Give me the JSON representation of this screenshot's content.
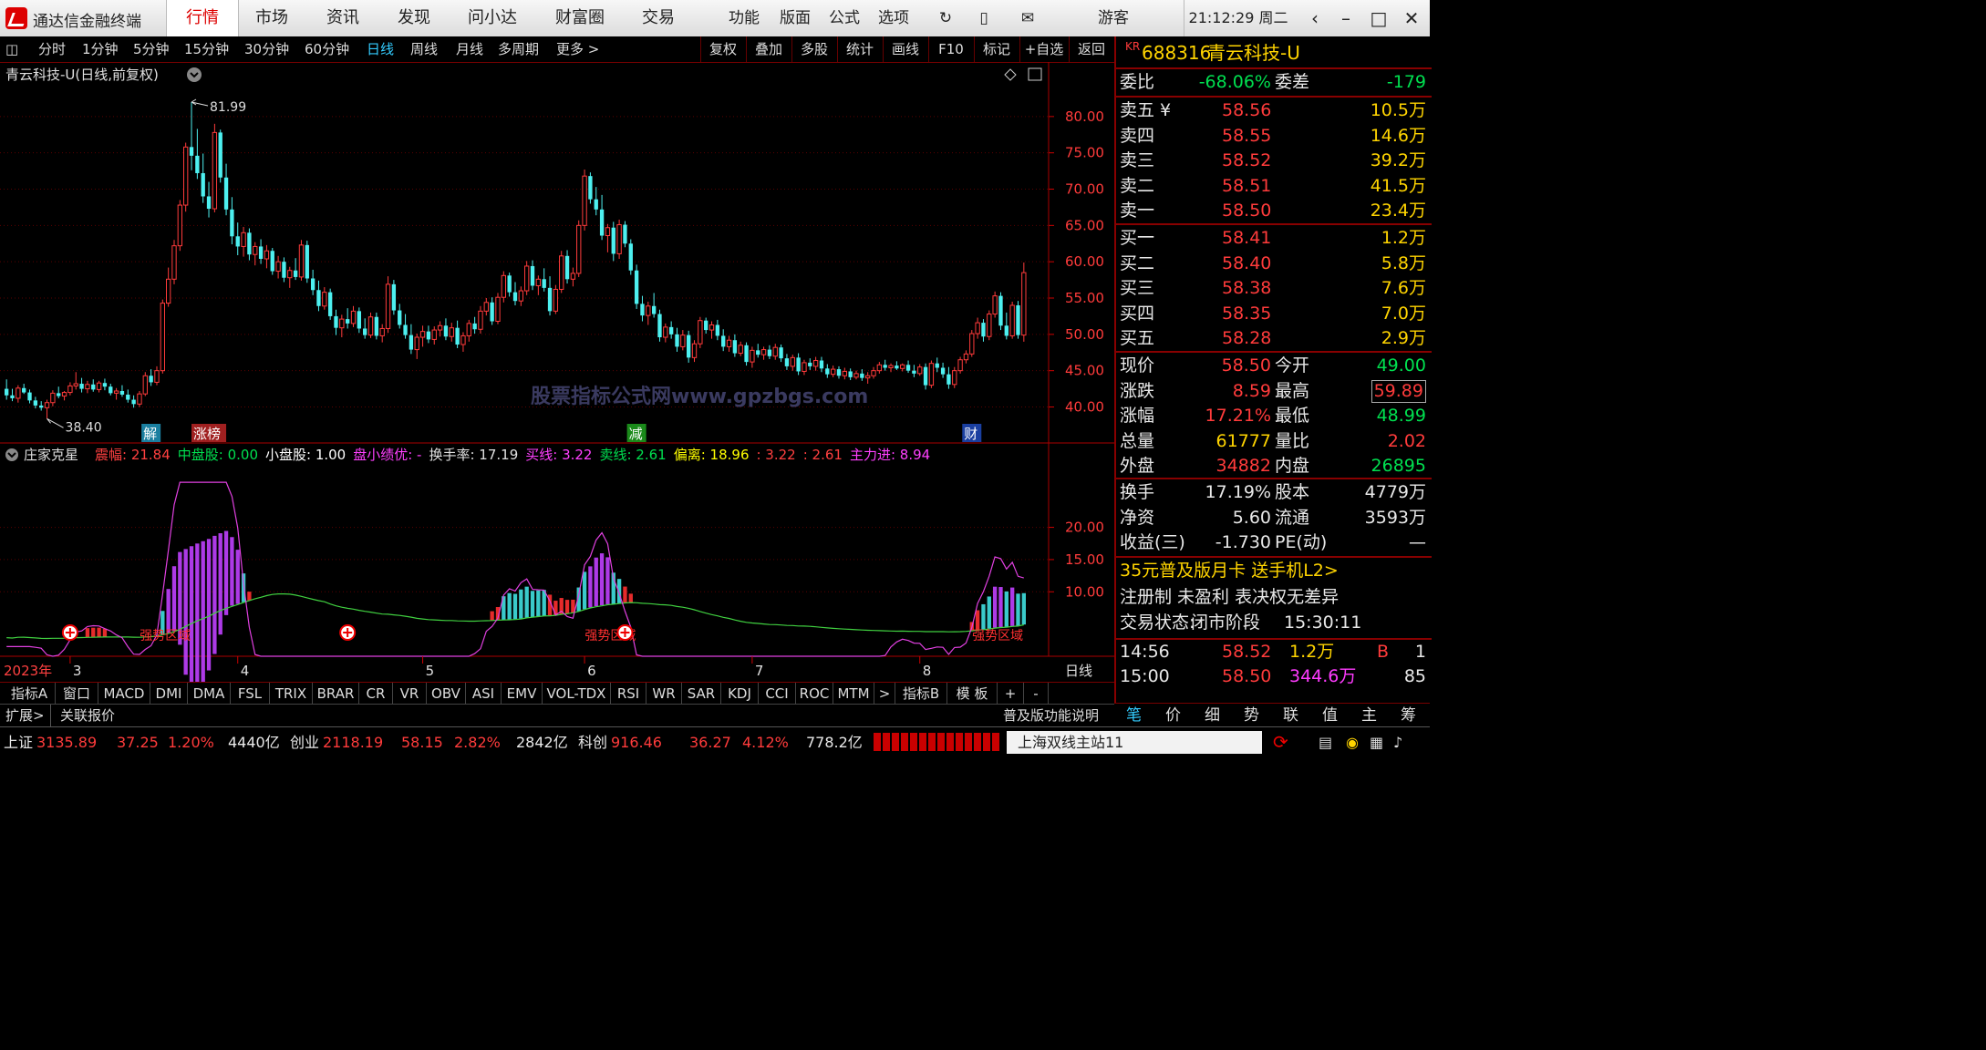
{
  "window": {
    "app_title": "通达信金融终端",
    "nav_tabs": [
      "行情",
      "市场",
      "资讯",
      "发现",
      "问小达",
      "财富圈",
      "交易"
    ],
    "active_tab": 0,
    "tools": [
      "功能",
      "版面",
      "公式",
      "选项"
    ],
    "guest": "游客",
    "clock": "21:12:29 周二"
  },
  "toolbar": {
    "periods": [
      "分时",
      "1分钟",
      "5分钟",
      "15分钟",
      "30分钟",
      "60分钟",
      "日线",
      "周线",
      "月线",
      "多周期",
      "更多 >"
    ],
    "active_period": 6,
    "right_buttons": [
      "复权",
      "叠加",
      "多股",
      "统计",
      "画线",
      "F10",
      "标记",
      "+自选",
      "返回"
    ]
  },
  "main_chart": {
    "title": "青云科技-U(日线,前复权)",
    "y_ticks": [
      "80.00",
      "75.00",
      "70.00",
      "65.00",
      "60.00",
      "55.00",
      "50.00",
      "45.00",
      "40.00"
    ],
    "y_range": [
      36.8,
      84.5
    ],
    "high_label": "81.99",
    "low_label": "38.40",
    "events": [
      {
        "label": "解",
        "color": "#1a7fa0",
        "bar": 25
      },
      {
        "label": "涨榜",
        "color": "#a02020",
        "bar": 35
      },
      {
        "label": "减",
        "color": "#1a8a1a",
        "bar": 109
      },
      {
        "label": "财",
        "color": "#1a3fa0",
        "bar": 167
      }
    ],
    "watermark": "股票指标公式网www.gpzbgs.com",
    "colors": {
      "up": "#ff3b3b",
      "down": "#4df0f0",
      "grid": "#5a0000"
    }
  },
  "indicator": {
    "name": "庄家克星",
    "legend": [
      {
        "text": "震幅: 21.84",
        "color": "#ff4040"
      },
      {
        "text": "中盘股: 0.00",
        "color": "#00e050"
      },
      {
        "text": "小盘股: 1.00",
        "color": "#ffffff"
      },
      {
        "text": "盘小绩优: -",
        "color": "#ff40ff"
      },
      {
        "text": "换手率: 17.19",
        "color": "#e0e0e0"
      },
      {
        "text": "买线: 3.22",
        "color": "#ff40ff"
      },
      {
        "text": "卖线: 2.61",
        "color": "#00e050"
      },
      {
        "text": "偏离: 18.96",
        "color": "#ffff00"
      },
      {
        "text": ": 3.22",
        "color": "#ff4040"
      },
      {
        "text": ": 2.61",
        "color": "#ff4040"
      },
      {
        "text": "主力进: 8.94",
        "color": "#ff40ff"
      }
    ],
    "y_ticks": [
      "20.00",
      "15.00",
      "10.00"
    ],
    "y_range": [
      0,
      28
    ],
    "zone_label": "强势区域",
    "year_label": "2023年",
    "month_labels": [
      {
        "label": "3",
        "bar": 11
      },
      {
        "label": "4",
        "bar": 40
      },
      {
        "label": "5",
        "bar": 72
      },
      {
        "label": "6",
        "bar": 100
      },
      {
        "label": "7",
        "bar": 129
      },
      {
        "label": "8",
        "bar": 158
      }
    ],
    "period_label": "日线"
  },
  "chart_data": {
    "type": "candlestick",
    "title": "青云科技-U(日线,前复权)",
    "ylim": [
      36.8,
      84.5
    ],
    "candles": [
      [
        42.5,
        43.8,
        41.0,
        41.6
      ],
      [
        41.6,
        42.5,
        40.8,
        41.2
      ],
      [
        41.2,
        43.0,
        40.6,
        42.6
      ],
      [
        42.6,
        43.2,
        41.8,
        42.0
      ],
      [
        42.0,
        42.4,
        40.5,
        40.9
      ],
      [
        40.9,
        41.4,
        39.8,
        40.2
      ],
      [
        40.2,
        40.8,
        39.5,
        39.9
      ],
      [
        39.9,
        41.0,
        38.4,
        40.6
      ],
      [
        40.6,
        42.3,
        40.1,
        41.9
      ],
      [
        41.9,
        42.8,
        41.2,
        41.5
      ],
      [
        41.5,
        42.2,
        40.9,
        42.0
      ],
      [
        42.0,
        43.4,
        41.6,
        42.9
      ],
      [
        42.9,
        44.8,
        42.4,
        43.2
      ],
      [
        43.2,
        44.0,
        42.0,
        42.5
      ],
      [
        42.5,
        43.6,
        41.9,
        43.1
      ],
      [
        43.1,
        43.8,
        42.1,
        42.4
      ],
      [
        42.4,
        43.6,
        42.0,
        43.3
      ],
      [
        43.3,
        43.9,
        42.3,
        42.8
      ],
      [
        42.8,
        43.2,
        41.6,
        41.9
      ],
      [
        41.9,
        42.6,
        41.0,
        42.2
      ],
      [
        42.2,
        43.0,
        41.4,
        41.7
      ],
      [
        41.7,
        42.4,
        40.6,
        41.0
      ],
      [
        41.0,
        41.6,
        39.9,
        40.4
      ],
      [
        40.4,
        42.2,
        40.0,
        41.8
      ],
      [
        41.8,
        44.8,
        41.5,
        44.3
      ],
      [
        44.3,
        45.2,
        42.9,
        43.4
      ],
      [
        43.4,
        45.6,
        43.0,
        45.0
      ],
      [
        45.0,
        54.8,
        44.6,
        54.3
      ],
      [
        54.3,
        59.2,
        53.8,
        57.6
      ],
      [
        57.6,
        63.0,
        56.9,
        62.2
      ],
      [
        62.2,
        68.5,
        61.5,
        67.8
      ],
      [
        67.8,
        76.4,
        66.9,
        75.8
      ],
      [
        75.8,
        81.99,
        72.6,
        74.6
      ],
      [
        74.6,
        78.3,
        71.4,
        72.2
      ],
      [
        72.2,
        74.9,
        68.1,
        69.0
      ],
      [
        69.0,
        71.0,
        66.1,
        67.3
      ],
      [
        67.3,
        79.0,
        66.8,
        77.8
      ],
      [
        77.8,
        78.2,
        70.9,
        71.6
      ],
      [
        71.6,
        73.5,
        66.4,
        67.2
      ],
      [
        67.2,
        68.9,
        62.4,
        63.5
      ],
      [
        63.5,
        65.4,
        60.9,
        62.1
      ],
      [
        62.1,
        64.8,
        60.7,
        64.0
      ],
      [
        64.0,
        64.6,
        60.2,
        61.0
      ],
      [
        61.0,
        62.7,
        59.5,
        62.1
      ],
      [
        62.1,
        63.1,
        59.7,
        60.4
      ],
      [
        60.4,
        62.3,
        59.1,
        61.5
      ],
      [
        61.5,
        61.9,
        58.2,
        58.7
      ],
      [
        58.7,
        60.8,
        57.7,
        60.0
      ],
      [
        60.0,
        60.6,
        57.2,
        57.8
      ],
      [
        57.8,
        59.3,
        56.4,
        58.8
      ],
      [
        58.8,
        60.5,
        57.5,
        57.9
      ],
      [
        57.9,
        63.0,
        57.4,
        62.3
      ],
      [
        62.3,
        62.9,
        57.1,
        57.7
      ],
      [
        57.7,
        58.9,
        55.4,
        56.1
      ],
      [
        56.1,
        57.4,
        53.2,
        53.9
      ],
      [
        53.9,
        56.5,
        53.4,
        55.8
      ],
      [
        55.8,
        56.3,
        52.0,
        52.5
      ],
      [
        52.5,
        53.4,
        49.9,
        50.9
      ],
      [
        50.9,
        52.7,
        49.6,
        52.1
      ],
      [
        52.1,
        53.6,
        50.8,
        51.5
      ],
      [
        51.5,
        53.9,
        51.0,
        53.2
      ],
      [
        53.2,
        53.7,
        50.2,
        50.8
      ],
      [
        50.8,
        52.2,
        49.4,
        49.9
      ],
      [
        49.9,
        53.0,
        49.5,
        52.4
      ],
      [
        52.4,
        53.0,
        49.3,
        49.8
      ],
      [
        49.8,
        51.4,
        48.9,
        50.8
      ],
      [
        50.8,
        58.0,
        50.2,
        56.9
      ],
      [
        56.9,
        57.5,
        52.7,
        53.3
      ],
      [
        53.3,
        54.2,
        50.8,
        51.3
      ],
      [
        51.3,
        52.8,
        49.4,
        49.9
      ],
      [
        49.9,
        51.4,
        47.3,
        47.9
      ],
      [
        47.9,
        50.1,
        46.6,
        49.6
      ],
      [
        49.6,
        51.2,
        48.3,
        50.4
      ],
      [
        50.4,
        51.2,
        48.8,
        49.3
      ],
      [
        49.3,
        51.1,
        48.6,
        50.6
      ],
      [
        50.6,
        51.8,
        49.7,
        51.2
      ],
      [
        51.2,
        52.2,
        49.2,
        49.7
      ],
      [
        49.7,
        51.6,
        49.0,
        50.9
      ],
      [
        50.9,
        51.9,
        48.1,
        48.6
      ],
      [
        48.6,
        50.3,
        47.6,
        49.8
      ],
      [
        49.8,
        52.0,
        49.0,
        51.5
      ],
      [
        51.5,
        52.4,
        50.1,
        50.7
      ],
      [
        50.7,
        53.9,
        50.1,
        53.2
      ],
      [
        53.2,
        55.0,
        52.6,
        54.4
      ],
      [
        54.4,
        55.1,
        51.3,
        51.8
      ],
      [
        51.8,
        55.7,
        51.4,
        55.1
      ],
      [
        55.1,
        58.7,
        54.4,
        58.1
      ],
      [
        58.1,
        58.5,
        55.2,
        55.8
      ],
      [
        55.8,
        57.2,
        54.0,
        54.6
      ],
      [
        54.6,
        56.6,
        53.9,
        56.0
      ],
      [
        56.0,
        60.1,
        55.4,
        59.4
      ],
      [
        59.4,
        60.2,
        56.1,
        56.7
      ],
      [
        56.7,
        58.1,
        55.4,
        57.6
      ],
      [
        57.6,
        59.1,
        55.9,
        56.4
      ],
      [
        56.4,
        58.0,
        52.6,
        53.2
      ],
      [
        53.2,
        56.8,
        52.8,
        56.2
      ],
      [
        56.2,
        61.5,
        55.7,
        60.8
      ],
      [
        60.8,
        61.6,
        57.0,
        57.6
      ],
      [
        57.6,
        59.2,
        56.6,
        58.4
      ],
      [
        58.4,
        65.7,
        57.9,
        65.0
      ],
      [
        65.0,
        72.7,
        64.3,
        71.8
      ],
      [
        71.8,
        72.3,
        68.0,
        68.6
      ],
      [
        68.6,
        70.3,
        66.4,
        67.2
      ],
      [
        67.2,
        69.2,
        63.0,
        63.6
      ],
      [
        63.6,
        65.2,
        61.3,
        64.7
      ],
      [
        64.7,
        65.5,
        60.1,
        61.1
      ],
      [
        61.1,
        65.8,
        60.4,
        65.1
      ],
      [
        65.1,
        65.6,
        62.0,
        62.5
      ],
      [
        62.5,
        63.1,
        58.2,
        58.8
      ],
      [
        58.8,
        59.6,
        53.5,
        54.2
      ],
      [
        54.2,
        55.3,
        51.8,
        52.6
      ],
      [
        52.6,
        54.5,
        51.3,
        53.9
      ],
      [
        53.9,
        55.7,
        52.3,
        52.8
      ],
      [
        52.8,
        53.4,
        49.0,
        49.6
      ],
      [
        49.6,
        51.5,
        48.9,
        51.0
      ],
      [
        51.0,
        51.8,
        49.4,
        50.0
      ],
      [
        50.0,
        50.9,
        47.6,
        48.3
      ],
      [
        48.3,
        50.6,
        47.8,
        49.9
      ],
      [
        49.9,
        50.5,
        46.1,
        46.8
      ],
      [
        46.8,
        49.2,
        46.2,
        48.7
      ],
      [
        48.7,
        52.4,
        48.1,
        51.9
      ],
      [
        51.9,
        52.3,
        50.1,
        50.6
      ],
      [
        50.6,
        51.8,
        49.4,
        51.3
      ],
      [
        51.3,
        52.0,
        49.2,
        49.8
      ],
      [
        49.8,
        50.7,
        47.7,
        48.3
      ],
      [
        48.3,
        49.8,
        47.6,
        49.2
      ],
      [
        49.2,
        50.0,
        46.9,
        47.4
      ],
      [
        47.4,
        49.0,
        47.0,
        48.5
      ],
      [
        48.5,
        48.9,
        45.7,
        46.2
      ],
      [
        46.2,
        48.3,
        45.4,
        47.8
      ],
      [
        47.8,
        48.7,
        46.8,
        47.2
      ],
      [
        47.2,
        48.3,
        46.5,
        47.9
      ],
      [
        47.9,
        48.5,
        46.6,
        47.0
      ],
      [
        47.0,
        48.7,
        46.5,
        48.2
      ],
      [
        48.2,
        48.6,
        46.2,
        46.7
      ],
      [
        46.7,
        47.3,
        45.1,
        45.6
      ],
      [
        45.6,
        47.2,
        45.0,
        46.8
      ],
      [
        46.8,
        47.4,
        44.4,
        44.9
      ],
      [
        44.9,
        46.5,
        44.4,
        46.1
      ],
      [
        46.1,
        46.7,
        45.1,
        45.6
      ],
      [
        45.6,
        46.9,
        45.0,
        46.4
      ],
      [
        46.4,
        46.9,
        44.8,
        45.3
      ],
      [
        45.3,
        45.9,
        44.0,
        44.5
      ],
      [
        44.5,
        45.7,
        44.1,
        45.2
      ],
      [
        45.2,
        45.6,
        43.9,
        44.3
      ],
      [
        44.3,
        45.4,
        43.8,
        44.9
      ],
      [
        44.9,
        45.3,
        43.7,
        44.1
      ],
      [
        44.1,
        45.0,
        43.8,
        44.6
      ],
      [
        44.6,
        45.2,
        43.6,
        44.0
      ],
      [
        44.0,
        44.8,
        43.2,
        44.3
      ],
      [
        44.3,
        45.5,
        43.9,
        45.0
      ],
      [
        45.0,
        46.2,
        44.6,
        45.8
      ],
      [
        45.8,
        46.5,
        45.0,
        45.4
      ],
      [
        45.4,
        46.0,
        44.8,
        45.7
      ],
      [
        45.7,
        46.3,
        45.1,
        45.3
      ],
      [
        45.3,
        46.0,
        44.9,
        45.8
      ],
      [
        45.8,
        46.4,
        44.7,
        45.0
      ],
      [
        45.0,
        45.8,
        44.1,
        44.6
      ],
      [
        44.6,
        45.9,
        44.3,
        45.5
      ],
      [
        45.5,
        46.0,
        42.4,
        43.0
      ],
      [
        43.0,
        46.4,
        42.6,
        46.0
      ],
      [
        46.0,
        46.8,
        44.8,
        45.4
      ],
      [
        45.4,
        46.1,
        44.0,
        44.5
      ],
      [
        44.5,
        45.5,
        42.5,
        43.1
      ],
      [
        43.1,
        45.5,
        42.6,
        45.0
      ],
      [
        45.0,
        46.9,
        44.6,
        46.5
      ],
      [
        46.5,
        47.8,
        46.0,
        47.3
      ],
      [
        47.3,
        50.6,
        46.9,
        50.1
      ],
      [
        50.1,
        52.3,
        49.4,
        51.6
      ],
      [
        51.6,
        52.1,
        49.0,
        49.7
      ],
      [
        49.7,
        53.3,
        49.2,
        52.8
      ],
      [
        52.8,
        55.9,
        52.3,
        55.3
      ],
      [
        55.3,
        55.8,
        50.6,
        51.2
      ],
      [
        51.2,
        53.0,
        49.3,
        49.8
      ],
      [
        49.8,
        54.5,
        49.4,
        54.0
      ],
      [
        54.0,
        54.6,
        49.4,
        49.9
      ],
      [
        49.9,
        59.89,
        48.99,
        58.5
      ]
    ]
  },
  "quote": {
    "code_prefix": "KR",
    "code": "688316",
    "name": "青云科技-U",
    "wb_label": "委比",
    "wb": "-68.06%",
    "wc_label": "委差",
    "wc": "-179",
    "asks": [
      {
        "label": "卖五 ¥",
        "price": "58.56",
        "vol": "10.5万"
      },
      {
        "label": "卖四",
        "price": "58.55",
        "vol": "14.6万"
      },
      {
        "label": "卖三",
        "price": "58.52",
        "vol": "39.2万"
      },
      {
        "label": "卖二",
        "price": "58.51",
        "vol": "41.5万"
      },
      {
        "label": "卖一",
        "price": "58.50",
        "vol": "23.4万"
      }
    ],
    "bids": [
      {
        "label": "买一",
        "price": "58.41",
        "vol": "1.2万"
      },
      {
        "label": "买二",
        "price": "58.40",
        "vol": "5.8万"
      },
      {
        "label": "买三",
        "price": "58.38",
        "vol": "7.6万"
      },
      {
        "label": "买四",
        "price": "58.35",
        "vol": "7.0万"
      },
      {
        "label": "买五",
        "price": "58.28",
        "vol": "2.9万"
      }
    ],
    "stats": [
      {
        "l1": "现价",
        "v1": "58.50",
        "c1": "red",
        "l2": "今开",
        "v2": "49.00",
        "c2": "green"
      },
      {
        "l1": "涨跌",
        "v1": "8.59",
        "c1": "red",
        "l2": "最高",
        "v2": "59.89",
        "c2": "red",
        "box": true
      },
      {
        "l1": "涨幅",
        "v1": "17.21%",
        "c1": "red",
        "l2": "最低",
        "v2": "48.99",
        "c2": "green"
      },
      {
        "l1": "总量",
        "v1": "61777",
        "c1": "yellow",
        "l2": "量比",
        "v2": "2.02",
        "c2": "red"
      },
      {
        "l1": "外盘",
        "v1": "34882",
        "c1": "red",
        "l2": "内盘",
        "v2": "26895",
        "c2": "green"
      }
    ],
    "stats2": [
      {
        "l1": "换手",
        "v1": "17.19%",
        "l2": "股本",
        "v2": "4779万"
      },
      {
        "l1": "净资",
        "v1": "5.60",
        "l2": "流通",
        "v2": "3593万"
      },
      {
        "l1": "收益(三)",
        "v1": "-1.730",
        "l2": "PE(动)",
        "v2": "—"
      }
    ],
    "promo": "35元普及版月卡 送手机L2>",
    "tags": "注册制 未盈利 表决权无差异",
    "trade_status_label": "交易状态:",
    "trade_status": "闭市阶段",
    "trade_time": "15:30:11",
    "ticks": [
      {
        "time": "14:56",
        "price": "58.52",
        "vol": "1.2万",
        "flag": "B",
        "n": "1"
      },
      {
        "time": "15:00",
        "price": "58.50",
        "vol": "344.6万",
        "flag": "",
        "n": "85"
      }
    ]
  },
  "indicator_tabs": {
    "items": [
      "指标A",
      "窗口",
      "MACD",
      "DMI",
      "DMA",
      "FSL",
      "TRIX",
      "BRAR",
      "CR",
      "VR",
      "OBV",
      "ASI",
      "EMV",
      "VOL-TDX",
      "RSI",
      "WR",
      "SAR",
      "KDJ",
      "CCI",
      "ROC",
      "MTM",
      ">",
      "指标B",
      "模 板",
      "+",
      "-"
    ]
  },
  "ext_bar": {
    "items": [
      "扩展>",
      "关联报价"
    ],
    "right": "普及版功能说明"
  },
  "rp_tabs": [
    "笔",
    "价",
    "细",
    "势",
    "联",
    "值",
    "主",
    "筹"
  ],
  "statusbar": {
    "sh_label": "上证",
    "sh": "3135.89",
    "sh_chg": "37.25",
    "sh_pct": "1.20%",
    "sh_amt": "4440亿",
    "cy_label": "创业",
    "cy": "2118.19",
    "cy_chg": "58.15",
    "cy_pct": "2.82%",
    "cy_amt": "2842亿",
    "kc_label": "科创",
    "kc": "916.46",
    "kc_chg": "36.27",
    "kc_pct": "4.12%",
    "kc_amt": "778.2亿",
    "server": "上海双线主站11"
  }
}
